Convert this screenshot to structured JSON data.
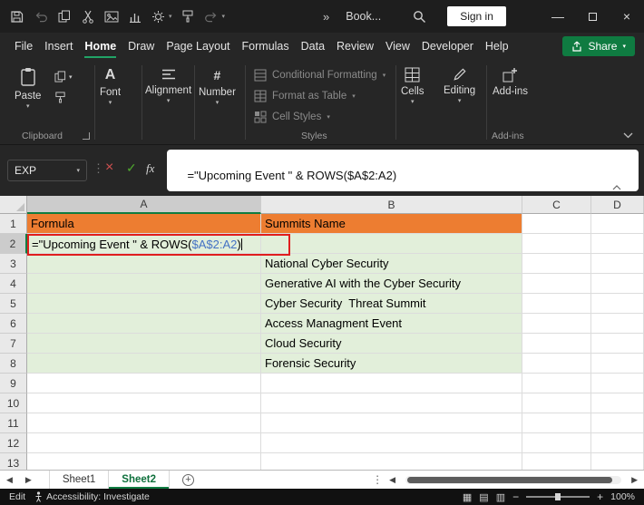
{
  "colors": {
    "accent_green": "#107C41",
    "share_green": "#0F7B41",
    "header_fill_orange": "#ED7D31",
    "data_fill_green": "#E2EFDA",
    "edit_border_red": "#E01E1E",
    "formula_ref_blue": "#4472C4",
    "titlebar_bg": "#1E1E1E",
    "ribbon_bg": "#262626"
  },
  "titlebar": {
    "title": "Book...",
    "sign_in_label": "Sign in",
    "quick_access_icons": [
      "save",
      "undo",
      "copy",
      "cut",
      "picture",
      "chart",
      "settings",
      "format-painter",
      "redo",
      "more"
    ]
  },
  "menu": {
    "items": [
      "File",
      "Insert",
      "Home",
      "Draw",
      "Page Layout",
      "Formulas",
      "Data",
      "Review",
      "View",
      "Developer",
      "Help"
    ],
    "active_item": "Home",
    "share_label": "Share"
  },
  "ribbon": {
    "paste_label": "Paste",
    "buttons": {
      "font": "Font",
      "alignment": "Alignment",
      "number": "Number",
      "conditional_formatting": "Conditional Formatting",
      "format_as_table": "Format as Table",
      "cell_styles": "Cell Styles",
      "cells": "Cells",
      "editing": "Editing",
      "addins": "Add-ins"
    },
    "group_labels": {
      "clipboard": "Clipboard",
      "styles": "Styles",
      "addins": "Add-ins"
    }
  },
  "formula_bar": {
    "name_box": "EXP",
    "formula_prefix": "=\"Upcoming Event \" & ROWS(",
    "formula_ref": "$A$2:A2",
    "formula_suffix": ")"
  },
  "grid": {
    "columns": [
      "A",
      "B",
      "C",
      "D"
    ],
    "row_count": 13,
    "selected_column": "A",
    "selected_row": "2",
    "cells": {
      "A1": "Formula",
      "B1": "Summits Name",
      "B3": "National Cyber Security",
      "B4": "Generative AI with the Cyber Security",
      "B5": "Cyber Security  Threat Summit",
      "B6": "Access Managment Event",
      "B7": "Cloud Security",
      "B8": "Forensic Security"
    },
    "edit_cell": {
      "address": "A2",
      "formula_prefix": "=\"Upcoming Event \" & ROWS(",
      "formula_ref": "$A$2:A2",
      "formula_suffix": ")"
    }
  },
  "sheet_tabs": {
    "tabs": [
      {
        "name": "Sheet1",
        "active": false
      },
      {
        "name": "Sheet2",
        "active": true
      }
    ]
  },
  "status_bar": {
    "mode": "Edit",
    "accessibility": "Accessibility: Investigate",
    "zoom": "100%"
  }
}
